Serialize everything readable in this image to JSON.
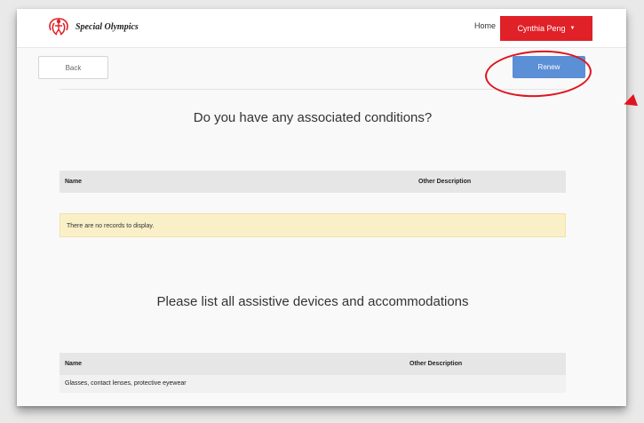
{
  "navbar": {
    "brand_text": "Special Olympics",
    "home_label": "Home",
    "user_label": "Cynthia Peng"
  },
  "toolbar": {
    "back_label": "Back",
    "renew_label": "Renew"
  },
  "conditions": {
    "heading": "Do you have any associated conditions?",
    "columns": [
      "Name",
      "Other Description"
    ],
    "empty_message": "There are no records to display."
  },
  "devices": {
    "heading": "Please list all assistive devices and accommodations",
    "columns": [
      "Name",
      "Other Description"
    ],
    "rows": [
      {
        "name": "Glasses, contact lenses, protective eyewear",
        "description": ""
      }
    ]
  },
  "colors": {
    "brand_red": "#e02127",
    "renew_blue": "#5b8fd6",
    "annotation_red": "#e0141e",
    "notice_yellow": "#faf0c8"
  }
}
